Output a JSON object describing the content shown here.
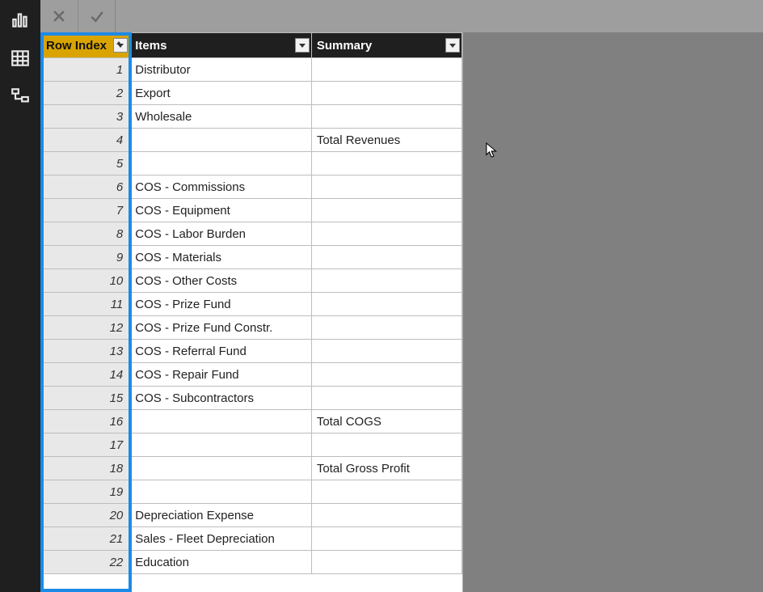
{
  "sidebar": {
    "items": [
      {
        "name": "report-view-icon"
      },
      {
        "name": "data-view-icon"
      },
      {
        "name": "model-view-icon"
      }
    ]
  },
  "formula_bar": {
    "cancel_tooltip": "Cancel",
    "commit_tooltip": "Enter",
    "value": ""
  },
  "grid": {
    "columns": {
      "row_index": {
        "label": "Row Index",
        "sorted_asc": true
      },
      "items": {
        "label": "Items"
      },
      "summary": {
        "label": "Summary"
      }
    },
    "rows": [
      {
        "row_index": "1",
        "items": "Distributor",
        "summary": ""
      },
      {
        "row_index": "2",
        "items": "Export",
        "summary": ""
      },
      {
        "row_index": "3",
        "items": "Wholesale",
        "summary": ""
      },
      {
        "row_index": "4",
        "items": "",
        "summary": "Total Revenues"
      },
      {
        "row_index": "5",
        "items": "",
        "summary": ""
      },
      {
        "row_index": "6",
        "items": "COS - Commissions",
        "summary": ""
      },
      {
        "row_index": "7",
        "items": "COS - Equipment",
        "summary": ""
      },
      {
        "row_index": "8",
        "items": "COS - Labor Burden",
        "summary": ""
      },
      {
        "row_index": "9",
        "items": "COS - Materials",
        "summary": ""
      },
      {
        "row_index": "10",
        "items": "COS - Other Costs",
        "summary": ""
      },
      {
        "row_index": "11",
        "items": "COS - Prize Fund",
        "summary": ""
      },
      {
        "row_index": "12",
        "items": "COS - Prize Fund Constr.",
        "summary": ""
      },
      {
        "row_index": "13",
        "items": "COS - Referral Fund",
        "summary": ""
      },
      {
        "row_index": "14",
        "items": "COS - Repair Fund",
        "summary": ""
      },
      {
        "row_index": "15",
        "items": "COS - Subcontractors",
        "summary": ""
      },
      {
        "row_index": "16",
        "items": "",
        "summary": "Total COGS"
      },
      {
        "row_index": "17",
        "items": "",
        "summary": ""
      },
      {
        "row_index": "18",
        "items": "",
        "summary": "Total Gross Profit"
      },
      {
        "row_index": "19",
        "items": "",
        "summary": ""
      },
      {
        "row_index": "20",
        "items": "Depreciation Expense",
        "summary": ""
      },
      {
        "row_index": "21",
        "items": "Sales - Fleet Depreciation",
        "summary": ""
      },
      {
        "row_index": "22",
        "items": "Education",
        "summary": ""
      }
    ]
  }
}
